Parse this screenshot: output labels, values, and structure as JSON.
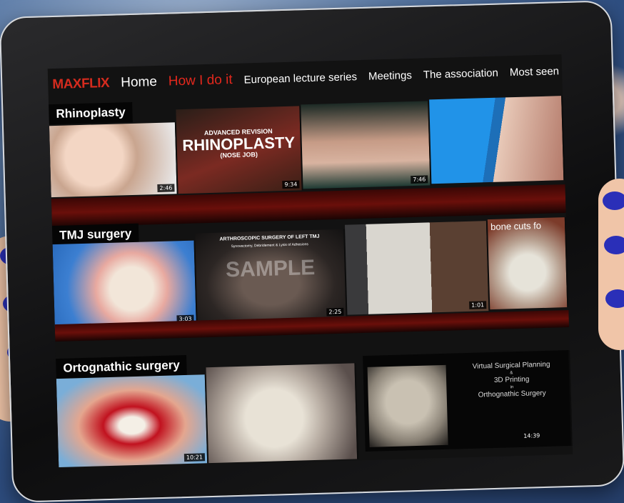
{
  "nav": {
    "logo": "MAXFLIX",
    "items": [
      {
        "label": "Home"
      },
      {
        "label": "How I  do it"
      },
      {
        "label": "European lecture series"
      },
      {
        "label": "Meetings"
      },
      {
        "label": "The association"
      },
      {
        "label": "Most seen"
      }
    ]
  },
  "rows": [
    {
      "title": "Rhinoplasty",
      "thumbs": [
        {
          "duration": "2:46"
        },
        {
          "heading1": "ADVANCED REVISION",
          "heading2": "RHINOPLASTY",
          "heading3": "(NOSE JOB)",
          "duration": "9:34"
        },
        {
          "duration": "7:46"
        },
        {
          "duration": ""
        }
      ]
    },
    {
      "title": "TMJ surgery",
      "thumbs": [
        {
          "duration": "3:03"
        },
        {
          "heading": "ARTHROSCOPIC SURGERY OF LEFT TMJ",
          "subheading": "Synovectomy, Debridement & Lysis of Adhesions",
          "watermark": "SAMPLE",
          "duration": "2:25"
        },
        {
          "duration": "1:01"
        },
        {
          "caption": "bone cuts fo"
        }
      ]
    },
    {
      "title": "Ortognathic surgery",
      "thumbs": [
        {
          "duration": "10:21"
        },
        {
          "duration": ""
        },
        {
          "line1": "Virtual Surgical Planning",
          "line2": "&",
          "line3": "3D Printing",
          "line4": "in",
          "line5": "Orthognathic Surgery",
          "duration": "14:39"
        }
      ]
    }
  ]
}
